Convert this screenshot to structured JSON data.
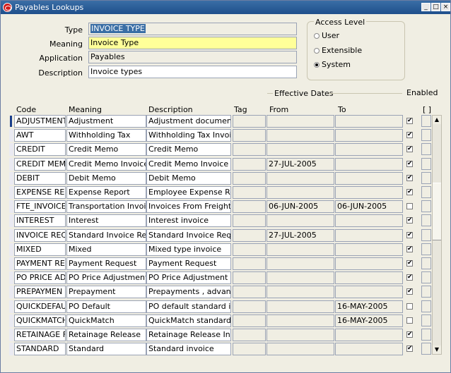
{
  "window": {
    "title": "Payables Lookups",
    "controls": [
      "_",
      "□",
      "×"
    ]
  },
  "form": {
    "type_label": "Type",
    "type_value": "INVOICE TYPE",
    "meaning_label": "Meaning",
    "meaning_value": "Invoice Type",
    "application_label": "Application",
    "application_value": "Payables",
    "description_label": "Description",
    "description_value": "Invoice types"
  },
  "access_level": {
    "title": "Access Level",
    "options": [
      "User",
      "Extensible",
      "System"
    ],
    "selected": "System"
  },
  "grid": {
    "effective_dates_label": "Effective Dates",
    "enabled_label": "Enabled",
    "dff_label": "[ ]",
    "columns": {
      "code": "Code",
      "meaning": "Meaning",
      "description": "Description",
      "tag": "Tag",
      "from": "From",
      "to": "To"
    },
    "rows": [
      {
        "code": "ADJUSTMENT",
        "meaning": "Adjustment",
        "description": "Adjustment document",
        "tag": "",
        "from": "",
        "to": "",
        "enabled": true
      },
      {
        "code": "AWT",
        "meaning": "Withholding Tax",
        "description": "Withholding Tax Invoice",
        "tag": "",
        "from": "",
        "to": "",
        "enabled": true
      },
      {
        "code": "CREDIT",
        "meaning": "Credit Memo",
        "description": "Credit Memo",
        "tag": "",
        "from": "",
        "to": "",
        "enabled": true
      },
      {
        "code": "CREDIT MEM",
        "meaning": "Credit Memo Invoice R",
        "description": "Credit Memo Invoice Re",
        "tag": "",
        "from": "27-JUL-2005",
        "to": "",
        "enabled": true
      },
      {
        "code": "DEBIT",
        "meaning": "Debit Memo",
        "description": "Debit Memo",
        "tag": "",
        "from": "",
        "to": "",
        "enabled": true
      },
      {
        "code": "EXPENSE RE",
        "meaning": "Expense Report",
        "description": "Employee Expense Rep",
        "tag": "",
        "from": "",
        "to": "",
        "enabled": true
      },
      {
        "code": "FTE_INVOICE",
        "meaning": "Transportation Invoices",
        "description": "Invoices From Freight Pa",
        "tag": "",
        "from": "06-JUN-2005",
        "to": "06-JUN-2005",
        "enabled": false
      },
      {
        "code": "INTEREST",
        "meaning": "Interest",
        "description": "Interest invoice",
        "tag": "",
        "from": "",
        "to": "",
        "enabled": true
      },
      {
        "code": "INVOICE REC",
        "meaning": "Standard Invoice Requ",
        "description": "Standard Invoice Reques",
        "tag": "",
        "from": "27-JUL-2005",
        "to": "",
        "enabled": true
      },
      {
        "code": "MIXED",
        "meaning": "Mixed",
        "description": "Mixed type invoice",
        "tag": "",
        "from": "",
        "to": "",
        "enabled": true
      },
      {
        "code": "PAYMENT RE",
        "meaning": "Payment Request",
        "description": "Payment Request",
        "tag": "",
        "from": "",
        "to": "",
        "enabled": true
      },
      {
        "code": "PO PRICE AD",
        "meaning": "PO Price Adjustment",
        "description": "PO Price Adjustment do",
        "tag": "",
        "from": "",
        "to": "",
        "enabled": true
      },
      {
        "code": "PREPAYMEN",
        "meaning": "Prepayment",
        "description": "Prepayments , advances",
        "tag": "",
        "from": "",
        "to": "",
        "enabled": true
      },
      {
        "code": "QUICKDEFAU",
        "meaning": "PO Default",
        "description": "PO default standard invo",
        "tag": "",
        "from": "",
        "to": "16-MAY-2005",
        "enabled": false
      },
      {
        "code": "QUICKMATCH",
        "meaning": "QuickMatch",
        "description": "QuickMatch standard im",
        "tag": "",
        "from": "",
        "to": "16-MAY-2005",
        "enabled": false
      },
      {
        "code": "RETAINAGE F",
        "meaning": "Retainage Release",
        "description": "Retainage Release Invoi",
        "tag": "",
        "from": "",
        "to": "",
        "enabled": true
      },
      {
        "code": "STANDARD",
        "meaning": "Standard",
        "description": "Standard invoice",
        "tag": "",
        "from": "",
        "to": "",
        "enabled": true
      }
    ]
  }
}
